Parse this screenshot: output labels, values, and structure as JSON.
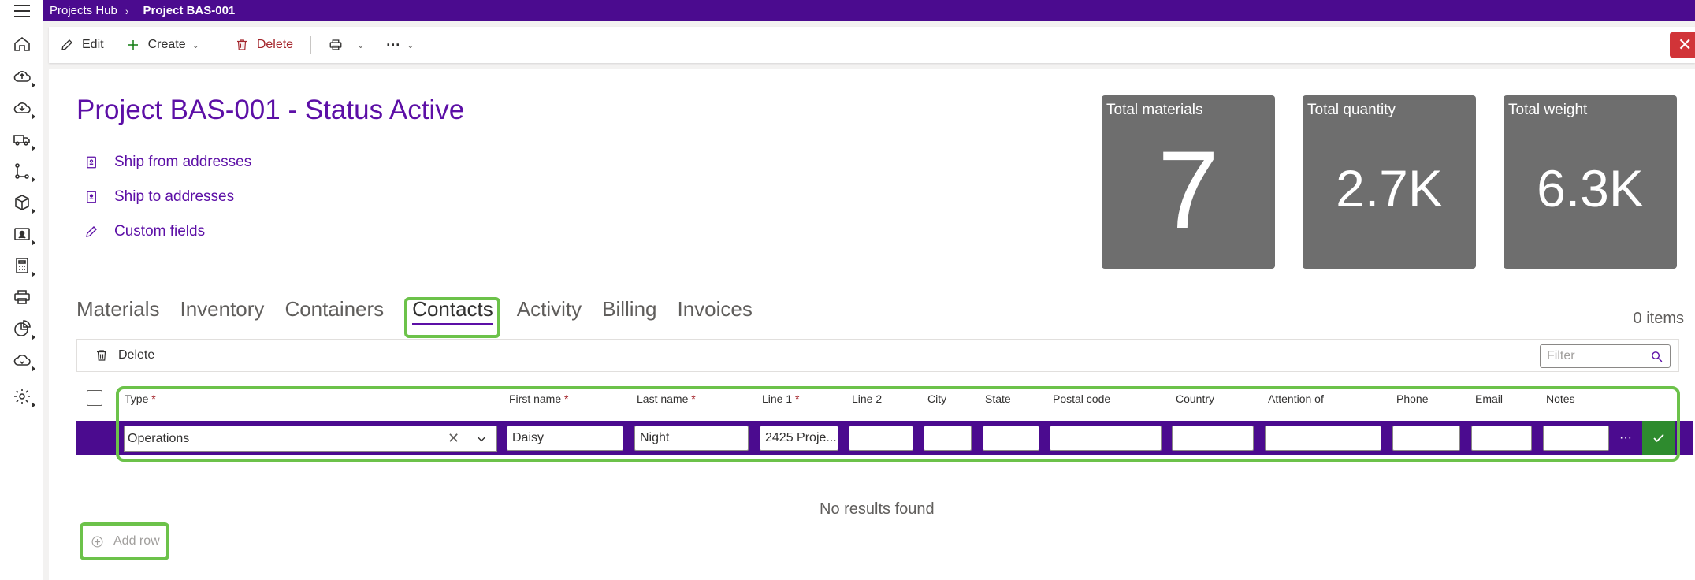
{
  "breadcrumb": {
    "root": "Projects Hub",
    "current": "Project BAS-001"
  },
  "toolbar": {
    "edit_label": "Edit",
    "create_label": "Create",
    "delete_label": "Delete",
    "print_icon": "printer-icon",
    "more_icon": "ellipsis-icon",
    "close_icon": "close-icon"
  },
  "leftnav": {
    "icons": [
      "home-icon",
      "cloud-upload-icon",
      "cloud-download-icon",
      "truck-icon",
      "flow-icon",
      "box-icon",
      "contact-card-icon",
      "calculator-icon",
      "printer-icon",
      "chart-icon",
      "cloud-sync-icon",
      "gear-icon"
    ]
  },
  "page": {
    "title": "Project BAS-001 - Status Active",
    "quick_links": [
      "Ship from addresses",
      "Ship to addresses",
      "Custom fields"
    ]
  },
  "tiles": [
    {
      "label": "Total materials",
      "value": "7"
    },
    {
      "label": "Total quantity",
      "value": "2.7K"
    },
    {
      "label": "Total weight",
      "value": "6.3K"
    }
  ],
  "tabs": [
    "Materials",
    "Inventory",
    "Containers",
    "Contacts",
    "Activity",
    "Billing",
    "Invoices"
  ],
  "active_tab": "Contacts",
  "items_count": "0 items",
  "grid": {
    "delete_label": "Delete",
    "filter_placeholder": "Filter",
    "columns": [
      {
        "label": "Type",
        "required": "*"
      },
      {
        "label": "First name",
        "required": "*"
      },
      {
        "label": "Last name",
        "required": "*"
      },
      {
        "label": "Line 1",
        "required": "*"
      },
      {
        "label": "Line 2",
        "required": ""
      },
      {
        "label": "City",
        "required": ""
      },
      {
        "label": "State",
        "required": ""
      },
      {
        "label": "Postal code",
        "required": ""
      },
      {
        "label": "Country",
        "required": ""
      },
      {
        "label": "Attention of",
        "required": ""
      },
      {
        "label": "Phone",
        "required": ""
      },
      {
        "label": "Email",
        "required": ""
      },
      {
        "label": "Notes",
        "required": ""
      }
    ],
    "edit_row": {
      "type": "Operations",
      "first_name": "Daisy",
      "last_name": "Night",
      "line1": "2425 Proje...",
      "line2": "",
      "city": "",
      "state": "",
      "postal_code": "",
      "country": "",
      "attention_of": "",
      "phone": "",
      "email": "",
      "notes": ""
    },
    "more_label": "···",
    "no_results": "No results found",
    "add_row_label": "Add row"
  },
  "colors": {
    "brand": "#4b0b8f",
    "accent": "#5c0fa6",
    "highlight": "#6cc24a",
    "tile": "#6e6e6e",
    "confirm": "#2e8b2e",
    "danger": "#d13438"
  }
}
